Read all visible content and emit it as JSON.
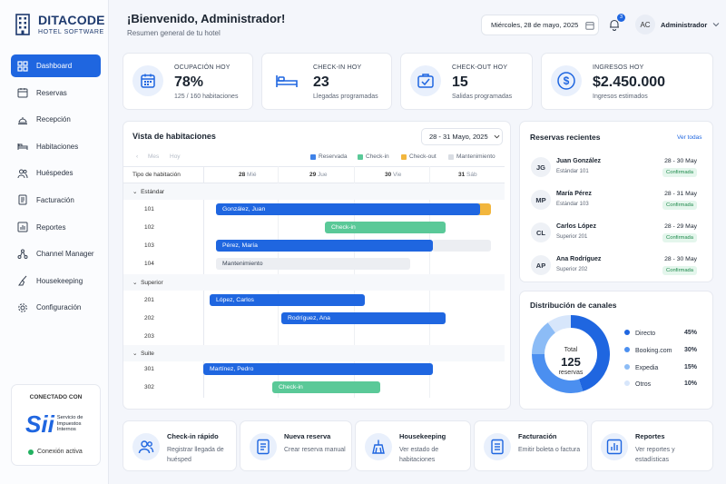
{
  "brand": {
    "name": "DITACODE",
    "subtitle": "HOTEL SOFTWARE"
  },
  "nav": [
    {
      "label": "Dashboard",
      "icon": "dashboard-icon",
      "active": true
    },
    {
      "label": "Reservas",
      "icon": "calendar-icon"
    },
    {
      "label": "Recepción",
      "icon": "reception-bell-icon"
    },
    {
      "label": "Habitaciones",
      "icon": "bed-icon"
    },
    {
      "label": "Huéspedes",
      "icon": "users-icon"
    },
    {
      "label": "Facturación",
      "icon": "invoice-icon"
    },
    {
      "label": "Reportes",
      "icon": "chart-icon"
    },
    {
      "label": "Channel Manager",
      "icon": "share-nodes-icon"
    },
    {
      "label": "Housekeeping",
      "icon": "broom-icon"
    },
    {
      "label": "Configuración",
      "icon": "gear-icon"
    }
  ],
  "sii": {
    "title": "CONECTADO CON",
    "logo": "Sii",
    "logo_text_1": "Servicio de",
    "logo_text_2": "Impuestos",
    "logo_text_3": "Internos",
    "status": "Conexión activa",
    "status_color": "#22b160"
  },
  "header": {
    "title": "¡Bienvenido, Administrador!",
    "subtitle": "Resumen general de tu hotel",
    "date": "Miércoles, 28 de mayo, 2025",
    "notifications": "3",
    "user_initials": "AC",
    "user_name": "Administrador"
  },
  "kpis": [
    {
      "label": "OCUPACIÓN HOY",
      "value": "78%",
      "sub": "125 / 160 habitaciones",
      "icon": "calendar-icon"
    },
    {
      "label": "CHECK-IN HOY",
      "value": "23",
      "sub": "Llegadas programadas",
      "icon": "bed-icon"
    },
    {
      "label": "CHECK-OUT HOY",
      "value": "15",
      "sub": "Salidas programadas",
      "icon": "suitcase-icon"
    },
    {
      "label": "INGRESOS HOY",
      "value": "$2.450.000",
      "sub": "Ingresos estimados",
      "icon": "dollar-icon"
    }
  ],
  "rooms_view": {
    "title": "Vista de habitaciones",
    "range": "28 - 31 Mayo, 2025",
    "nav_prev": "‹",
    "nav_next": "›",
    "view_month": "Mes",
    "view_today": "Hoy",
    "legend": [
      {
        "label": "Reservada",
        "color": "#3f82e8"
      },
      {
        "label": "Check-in",
        "color": "#5ac998"
      },
      {
        "label": "Check-out",
        "color": "#f2b63d"
      },
      {
        "label": "Mantenimiento",
        "color": "#d9dde3"
      }
    ],
    "col_header": "Tipo de habitación",
    "days": [
      {
        "num": "28",
        "name": "Mié"
      },
      {
        "num": "29",
        "name": "Jue"
      },
      {
        "num": "30",
        "name": "Vie"
      },
      {
        "num": "31",
        "name": "Sáb"
      }
    ],
    "groups": [
      "Estándar",
      "Superior",
      "Suite"
    ],
    "rooms": [
      "101",
      "102",
      "103",
      "104",
      "201",
      "202",
      "203",
      "301",
      "302"
    ],
    "bookings": [
      "González, Juan",
      "Check-in",
      "Pérez, María",
      "Mantenimiento",
      "López, Carlos",
      "Rodríguez, Ana",
      "Martínez, Pedro",
      "Check-in"
    ]
  },
  "reservations": {
    "title": "Reservas recientes",
    "link": "Ver todas",
    "items": [
      {
        "initials": "JG",
        "name": "Juan González",
        "room": "Estándar 101",
        "dates": "28 - 30 May",
        "status": "Confirmada"
      },
      {
        "initials": "MP",
        "name": "María Pérez",
        "room": "Estándar 103",
        "dates": "28 - 31 May",
        "status": "Confirmada"
      },
      {
        "initials": "CL",
        "name": "Carlos López",
        "room": "Superior 201",
        "dates": "28 - 29 May",
        "status": "Confirmada"
      },
      {
        "initials": "AP",
        "name": "Ana Rodríguez",
        "room": "Superior 202",
        "dates": "28 - 30 May",
        "status": "Confirmada"
      }
    ]
  },
  "channels": {
    "title": "Distribución de canales",
    "total_label": "Total",
    "total_value": "125",
    "total_unit": "reservas",
    "items": [
      {
        "label": "Directo",
        "value": 45,
        "pct": "45%",
        "color": "#1f66e0"
      },
      {
        "label": "Booking.com",
        "value": 30,
        "pct": "30%",
        "color": "#4b8ff0"
      },
      {
        "label": "Expedia",
        "value": 15,
        "pct": "15%",
        "color": "#8cbcf6"
      },
      {
        "label": "Otros",
        "value": 10,
        "pct": "10%",
        "color": "#d7e6fb"
      }
    ]
  },
  "quick_actions": [
    {
      "title": "Check-in rápido",
      "sub": "Registrar llegada de huésped",
      "icon": "users-icon"
    },
    {
      "title": "Nueva reserva",
      "sub": "Crear reserva manual",
      "icon": "document-icon"
    },
    {
      "title": "Housekeeping",
      "sub": "Ver estado de habitaciones",
      "icon": "broom-icon"
    },
    {
      "title": "Facturación",
      "sub": "Emitir boleta o factura",
      "icon": "invoice-icon"
    },
    {
      "title": "Reportes",
      "sub": "Ver reportes y estadísticas",
      "icon": "chart-icon"
    }
  ]
}
